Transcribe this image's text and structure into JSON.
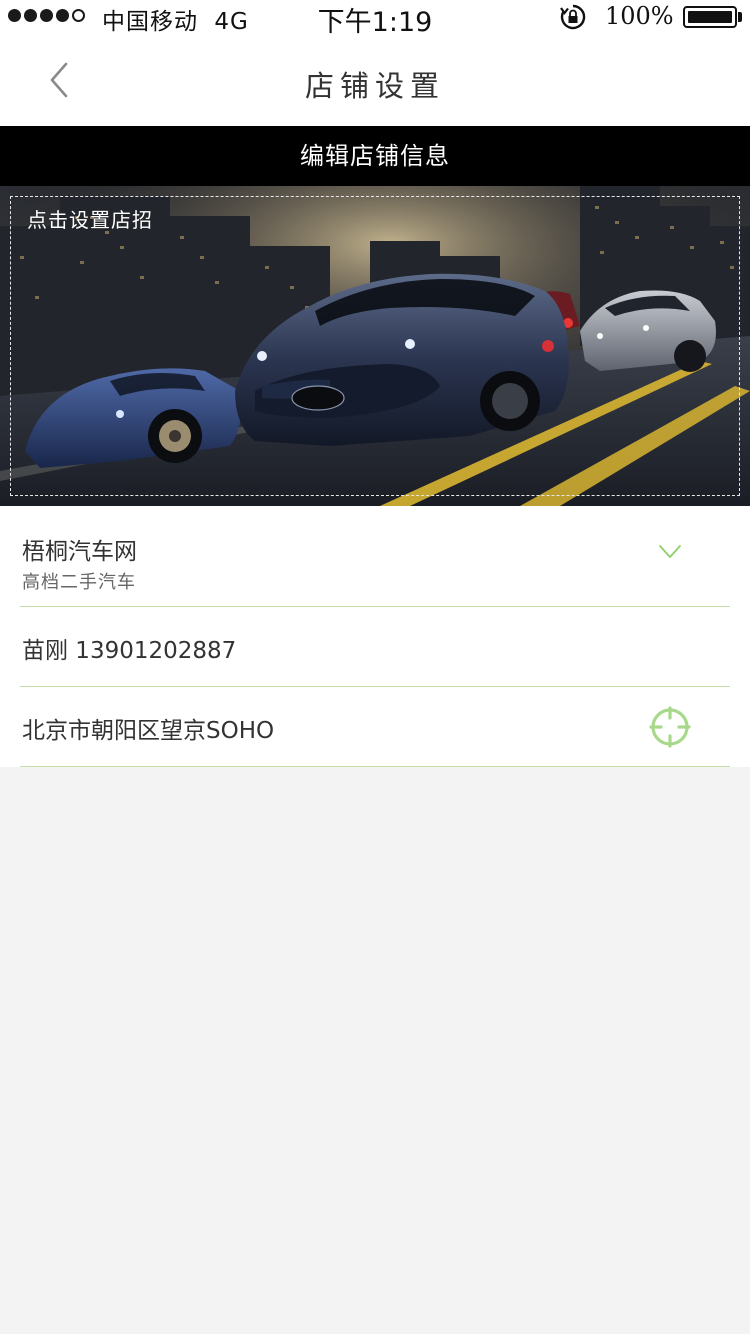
{
  "status_bar": {
    "carrier": "中国移动",
    "network": "4G",
    "time": "下午1:19",
    "battery_percent": "100%",
    "icons": [
      "signal-dots",
      "rotation-lock-icon",
      "battery-icon"
    ]
  },
  "nav": {
    "title": "店铺设置",
    "back_icon": "chevron-left-icon"
  },
  "edit_bar": {
    "label": "编辑店铺信息"
  },
  "banner": {
    "label": "点击设置店招",
    "image": "night city street scene with sports cars"
  },
  "form": {
    "shop_name": "梧桐汽车网",
    "shop_subtitle": "高档二手汽车",
    "contact": "苗刚 13901202887",
    "address": "北京市朝阳区望京SOHO",
    "expand_icon": "chevron-down-icon",
    "locate_icon": "crosshair-icon"
  },
  "colors": {
    "accent_green": "#8fcf6a",
    "divider_green": "#c2dfa8",
    "page_bg": "#f4f3f4"
  }
}
